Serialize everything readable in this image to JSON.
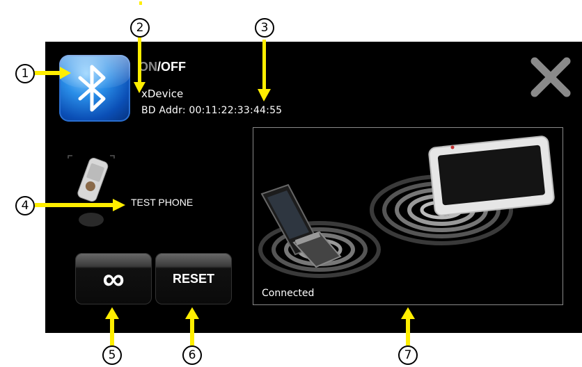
{
  "callouts": [
    "1",
    "2",
    "3",
    "4",
    "5",
    "6",
    "7"
  ],
  "header": {
    "power_on": "ON",
    "power_separator": "/",
    "power_off": "OFF",
    "device_name": "xDevice",
    "bd_address": "BD Addr: 00:11:22:33:44:55"
  },
  "phone": {
    "name": "TEST PHONE"
  },
  "buttons": {
    "pair_glyph": "∞",
    "reset_label": "RESET"
  },
  "status": {
    "text": "Connected"
  },
  "colors": {
    "panel": "#000000",
    "arrow": "#ffee00",
    "bluetooth": "#1a73d9"
  },
  "icons": [
    "bluetooth-icon",
    "close-icon",
    "phone-icon",
    "infinity-icon",
    "flip-phone",
    "display-device",
    "signal-waves"
  ]
}
